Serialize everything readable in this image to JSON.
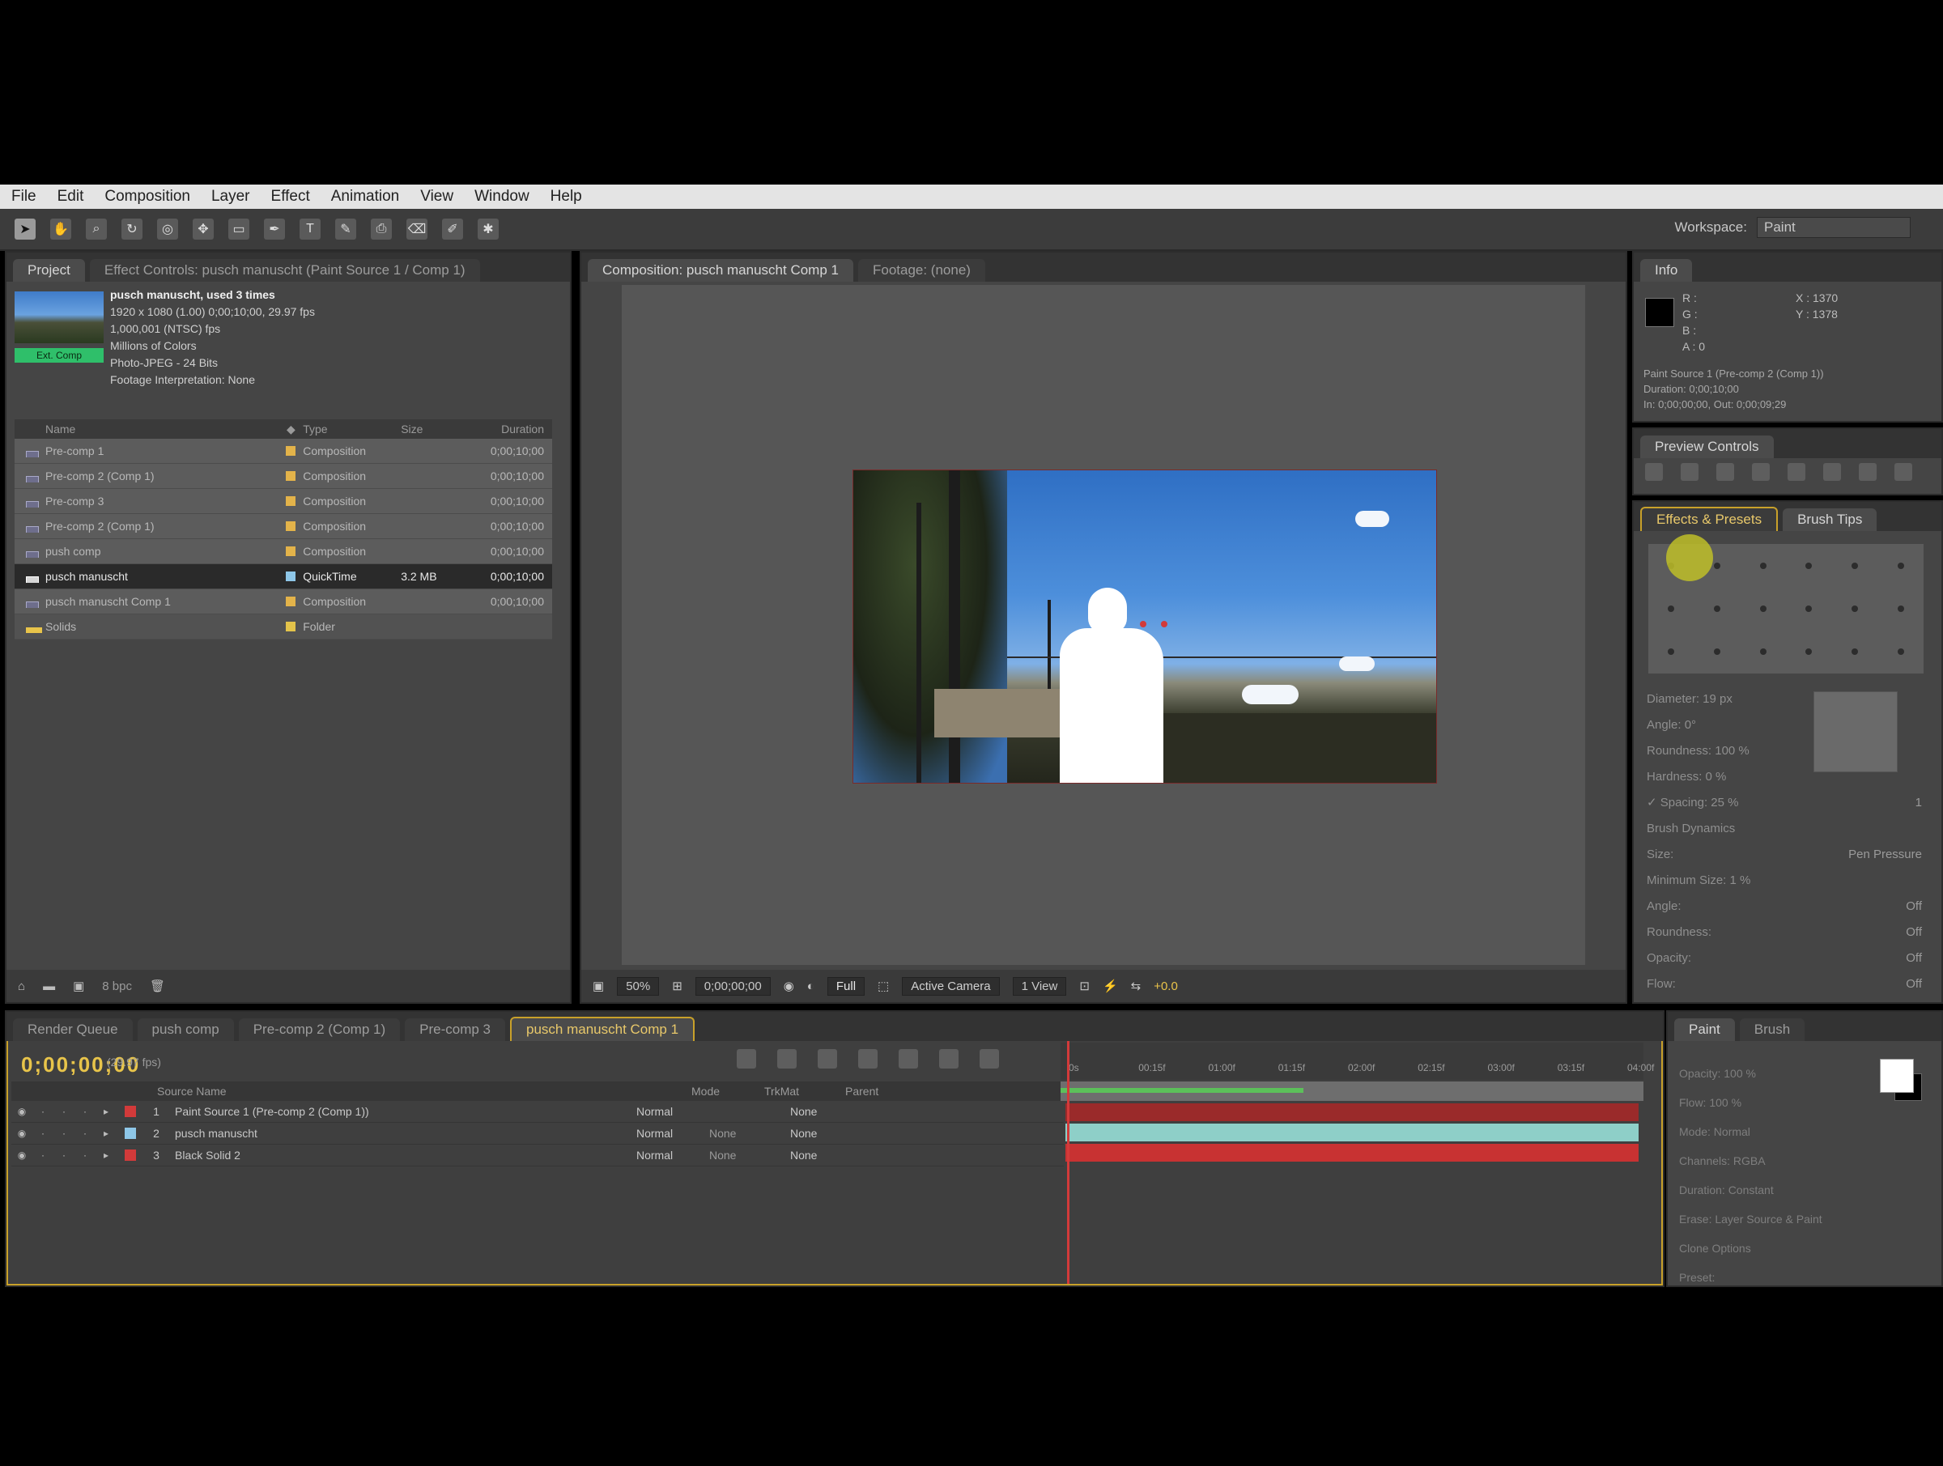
{
  "menu": [
    "File",
    "Edit",
    "Composition",
    "Layer",
    "Effect",
    "Animation",
    "View",
    "Window",
    "Help"
  ],
  "workspace": {
    "label": "Workspace:",
    "value": "Paint"
  },
  "project": {
    "tabs": [
      "Project",
      "Effect Controls: pusch manuscht (Paint Source 1 / Comp 1)"
    ],
    "info": {
      "name": "pusch manuscht, used 3 times",
      "line1": "1920 x 1080 (1.00) 0;00;10;00, 29.97 fps",
      "line2": "1,000,001 (NTSC) fps",
      "line3": "Millions of Colors",
      "line4": "Photo-JPEG - 24 Bits",
      "line5": "Footage Interpretation: None"
    },
    "badge": "Ext. Comp",
    "headers": {
      "name": "Name",
      "label": "",
      "type": "Type",
      "size": "Size",
      "duration": "Duration"
    },
    "rows": [
      {
        "name": "Pre-comp 1",
        "type": "Composition",
        "size": "",
        "duration": "0;00;10;00",
        "color": "#e3b34a",
        "icon": "comp"
      },
      {
        "name": "Pre-comp 2 (Comp 1)",
        "type": "Composition",
        "size": "",
        "duration": "0;00;10;00",
        "color": "#e3b34a",
        "icon": "comp"
      },
      {
        "name": "Pre-comp 3",
        "type": "Composition",
        "size": "",
        "duration": "0;00;10;00",
        "color": "#e3b34a",
        "icon": "comp"
      },
      {
        "name": "Pre-comp 2 (Comp 1)",
        "type": "Composition",
        "size": "",
        "duration": "0;00;10;00",
        "color": "#e3b34a",
        "icon": "comp"
      },
      {
        "name": "push comp",
        "type": "Composition",
        "size": "",
        "duration": "0;00;10;00",
        "color": "#e3b34a",
        "icon": "comp"
      },
      {
        "name": "pusch manuscht",
        "type": "QuickTime",
        "size": "3.2 MB",
        "duration": "0;00;10;00",
        "color": "#8ec7e8",
        "icon": "footage",
        "selected": true
      },
      {
        "name": "pusch manuscht Comp 1",
        "type": "Composition",
        "size": "",
        "duration": "0;00;10;00",
        "color": "#e3b34a",
        "icon": "comp"
      },
      {
        "name": "Solids",
        "type": "Folder",
        "size": "",
        "duration": "",
        "color": "#e3c34a",
        "icon": "folder"
      }
    ],
    "footer": {
      "bpc": "8 bpc"
    }
  },
  "composition": {
    "tabs": [
      "Composition: pusch manuscht Comp 1",
      "Footage: (none)"
    ],
    "bar": {
      "zoom": "50%",
      "timecode": "0;00;00;00",
      "res": "Full",
      "camera": "Active Camera",
      "views": "1 View",
      "plus": "+0.0"
    }
  },
  "info": {
    "tab": "Info",
    "rgb": [
      "R :",
      "G :",
      "B :",
      "A : 0"
    ],
    "xy": [
      "X : 1370",
      "Y : 1378"
    ],
    "text": [
      "Paint Source 1 (Pre-comp 2 (Comp 1))",
      "Duration: 0;00;10;00",
      "In: 0;00;00;00, Out: 0;00;09;29"
    ]
  },
  "preview": {
    "tab": "Preview Controls"
  },
  "effects": {
    "tabs": [
      "Effects & Presets",
      "Brush Tips"
    ],
    "props": [
      {
        "label": "Diameter: 19 px",
        "value": ""
      },
      {
        "label": "Angle: 0°",
        "value": ""
      },
      {
        "label": "Roundness: 100 %",
        "value": ""
      },
      {
        "label": "Hardness: 0 %",
        "value": ""
      },
      {
        "label": "✓ Spacing: 25 %",
        "value": "1"
      },
      {
        "label": "Brush Dynamics",
        "value": ""
      },
      {
        "label": "Size:",
        "value": "Pen Pressure"
      },
      {
        "label": "Minimum Size: 1 %",
        "value": ""
      },
      {
        "label": "Angle:",
        "value": "Off"
      },
      {
        "label": "Roundness:",
        "value": "Off"
      },
      {
        "label": "Opacity:",
        "value": "Off"
      },
      {
        "label": "Flow:",
        "value": "Off"
      }
    ]
  },
  "timeline": {
    "tabs": [
      "Render Queue",
      "push comp",
      "Pre-comp 2 (Comp 1)",
      "Pre-comp 3",
      "pusch manuscht Comp 1"
    ],
    "timecode": "0;00;00;00",
    "fps": "(29.97 fps)",
    "columns": {
      "name": "Source Name",
      "mode": "Mode",
      "trkmat": "TrkMat",
      "parent": "Parent"
    },
    "layers": [
      {
        "num": "1",
        "name": "Paint Source 1 (Pre-comp 2 (Comp 1))",
        "mode": "Normal",
        "trkmat": "",
        "parent": "None",
        "color": "#d23a3a",
        "track": "#9a2a2a"
      },
      {
        "num": "2",
        "name": "pusch manuscht",
        "mode": "Normal",
        "trkmat": "None",
        "parent": "None",
        "color": "#8ec7e8",
        "track": "#8ecfc8"
      },
      {
        "num": "3",
        "name": "Black Solid 2",
        "mode": "Normal",
        "trkmat": "None",
        "parent": "None",
        "color": "#d23a3a",
        "track": "#c83232"
      }
    ],
    "ruler": [
      "0s",
      "00:15f",
      "01:00f",
      "01:15f",
      "02:00f",
      "02:15f",
      "03:00f",
      "03:15f",
      "04:00f"
    ]
  },
  "paint": {
    "tabs": [
      "Paint",
      "Brush"
    ],
    "props": [
      "Opacity: 100 %",
      "Flow: 100 %",
      "Mode: Normal",
      "Channels: RGBA",
      "Duration: Constant",
      "Erase: Layer Source & Paint",
      "Clone Options",
      "Preset:"
    ]
  }
}
